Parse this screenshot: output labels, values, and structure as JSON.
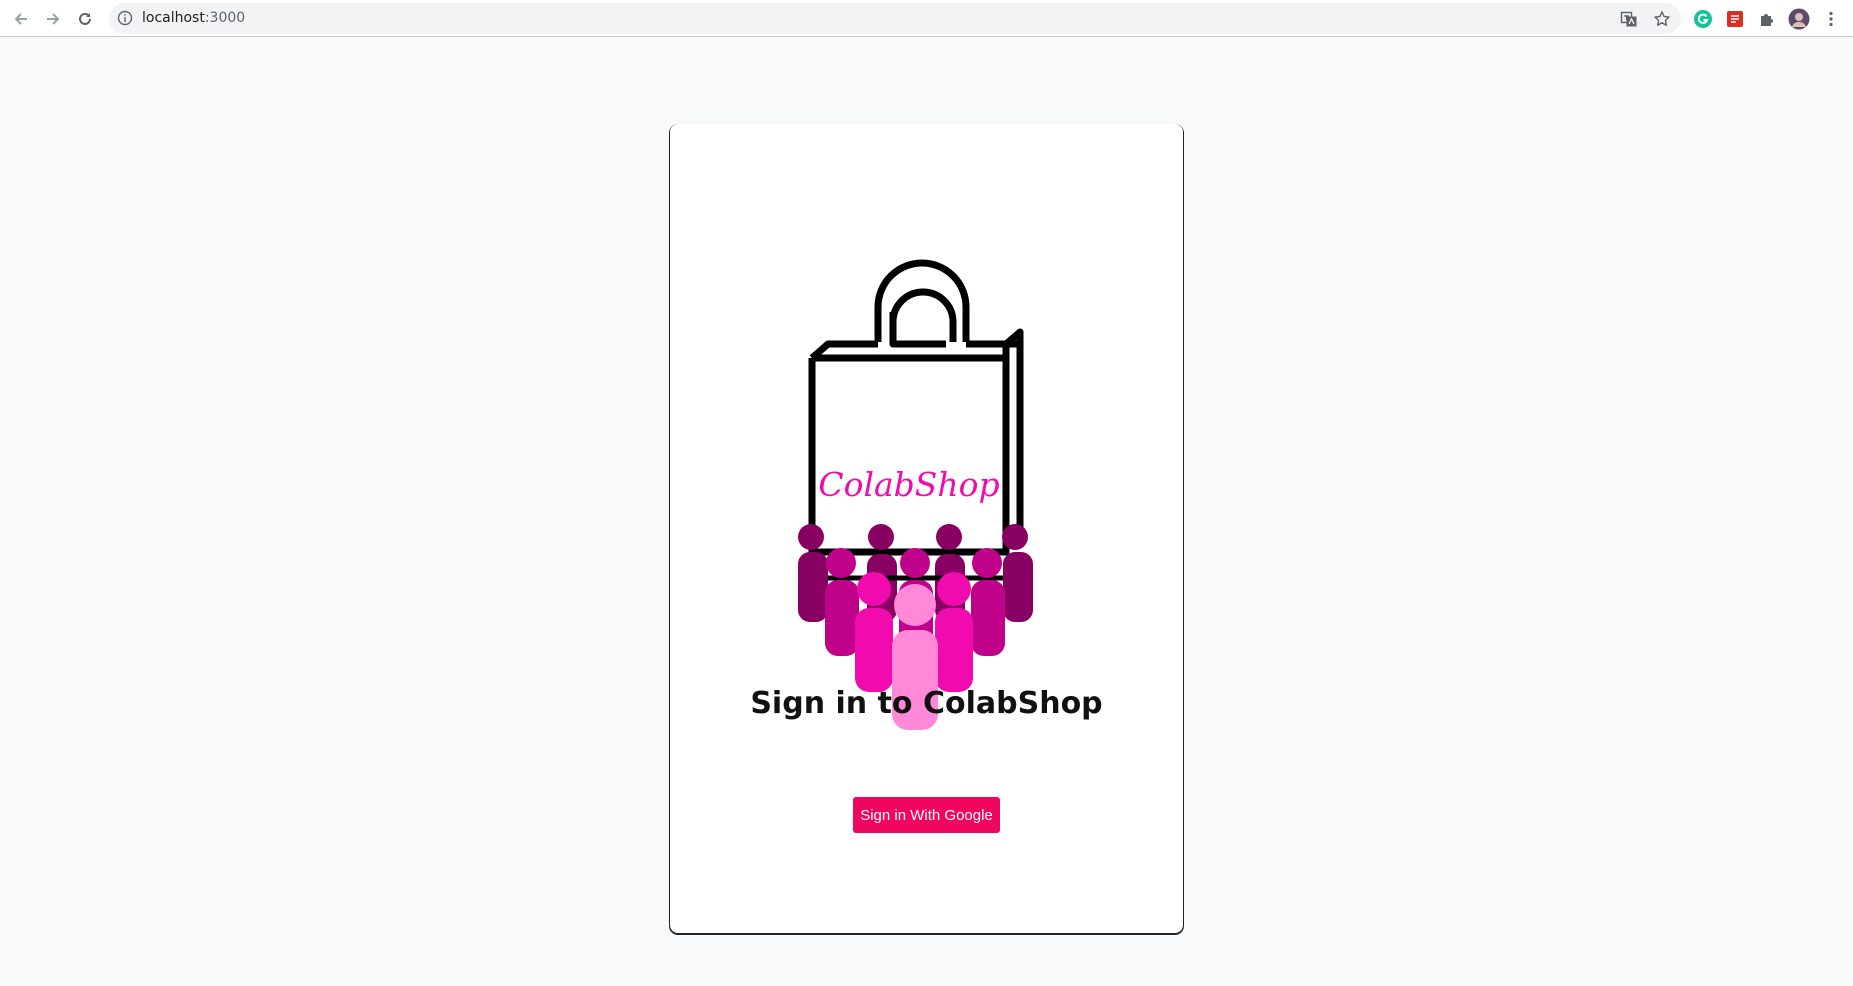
{
  "browser": {
    "url_host": "localhost",
    "url_port": ":3000",
    "icons": {
      "back": "arrow-left-icon",
      "forward": "arrow-right-icon",
      "reload": "reload-icon",
      "info": "info-icon",
      "translate": "translate-icon",
      "bookmark": "star-icon",
      "grammarly": "grammarly-extension-icon",
      "extension2": "red-extension-icon",
      "extensions": "puzzle-icon",
      "profile": "profile-avatar",
      "menu": "kebab-menu-icon"
    }
  },
  "login": {
    "logo_text": "ColabShop",
    "heading": "Sign in to ColabShop",
    "button_label": "Sign in With Google"
  },
  "colors": {
    "accent": "#f0055f",
    "page_background": "#f8f9fa",
    "logo_pink_light": "#ff88d9",
    "logo_pink": "#f10aae",
    "logo_magenta": "#c0028a",
    "logo_purple": "#880062"
  }
}
